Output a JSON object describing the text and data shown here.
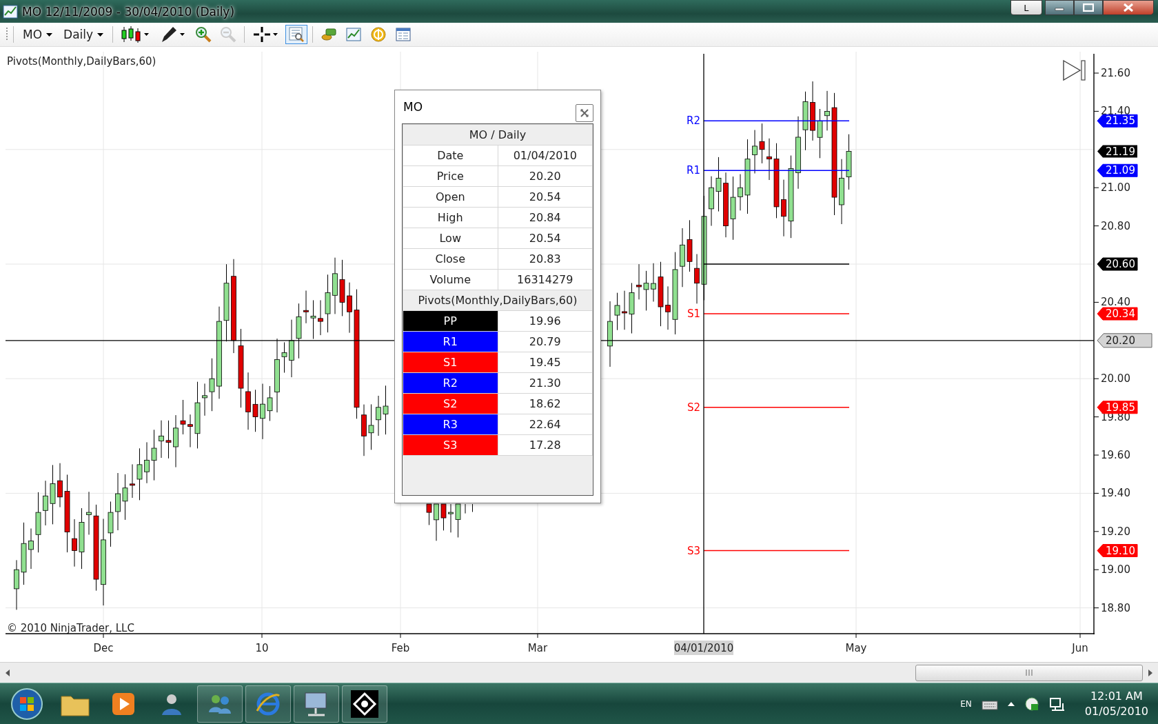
{
  "window": {
    "title": "MO  12/11/2009 - 30/04/2010 (Daily)",
    "buttons": [
      {
        "kind": "account",
        "label": "L"
      },
      {
        "kind": "minimize"
      },
      {
        "kind": "maximize"
      },
      {
        "kind": "close"
      }
    ]
  },
  "toolbar": {
    "instrument": "MO",
    "period": "Daily",
    "tools": [
      {
        "kind": "chart-style",
        "selected": false,
        "disabled": false
      },
      {
        "kind": "drawing",
        "selected": false,
        "disabled": false
      },
      {
        "kind": "zoom-in",
        "selected": false,
        "disabled": false
      },
      {
        "kind": "zoom-out",
        "selected": false,
        "disabled": true
      },
      {
        "kind": "crosshair",
        "selected": false,
        "disabled": false
      },
      {
        "kind": "data-box",
        "selected": true,
        "disabled": false
      },
      {
        "kind": "instruments",
        "selected": false,
        "disabled": false
      },
      {
        "kind": "indicators",
        "selected": false,
        "disabled": false
      },
      {
        "kind": "strategies",
        "selected": false,
        "disabled": false
      },
      {
        "kind": "properties",
        "selected": false,
        "disabled": false
      }
    ]
  },
  "chart": {
    "indicator": "Pivots(Monthly,DailyBars,60)",
    "copyright": "© 2010 NinjaTrader, LLC",
    "price_ticks": [
      "21.60",
      "21.40",
      "21.00",
      "20.80",
      "20.40",
      "20.00",
      "19.80",
      "19.60",
      "19.40",
      "19.20",
      "19.00",
      "18.80"
    ],
    "date_ticks": [
      "Dec",
      "10",
      "Feb",
      "Mar",
      "May",
      "Jun"
    ],
    "pivot_lines": [
      {
        "label": "R2",
        "marker": "21.35",
        "color": "#0000ff"
      },
      {
        "label": "R1",
        "marker": "21.09",
        "color": "#0000ff"
      },
      {
        "marker": "20.60",
        "color": "#000000"
      },
      {
        "label": "S1",
        "marker": "20.34",
        "color": "#ff0000"
      },
      {
        "label": "S2",
        "marker": "19.85",
        "color": "#ff0000"
      },
      {
        "label": "S3",
        "marker": "19.10",
        "color": "#ff0000"
      }
    ],
    "last_price": "21.19",
    "crosshair": {
      "price": "20.20",
      "date": "04/01/2010"
    }
  },
  "data_box": {
    "title": "MO",
    "header": "MO / Daily",
    "rows": [
      {
        "name": "Date",
        "value": "01/04/2010"
      },
      {
        "name": "Price",
        "value": "20.20"
      },
      {
        "name": "Open",
        "value": "20.54"
      },
      {
        "name": "High",
        "value": "20.84"
      },
      {
        "name": "Low",
        "value": "20.54"
      },
      {
        "name": "Close",
        "value": "20.83"
      },
      {
        "name": "Volume",
        "value": "16314279"
      }
    ],
    "section": "Pivots(Monthly,DailyBars,60)",
    "pivots": [
      {
        "name": "PP",
        "value": "19.96",
        "color": "#000000"
      },
      {
        "name": "R1",
        "value": "20.79",
        "color": "#0000ff"
      },
      {
        "name": "S1",
        "value": "19.45",
        "color": "#ff0000"
      },
      {
        "name": "R2",
        "value": "21.30",
        "color": "#0000ff"
      },
      {
        "name": "S2",
        "value": "18.62",
        "color": "#ff0000"
      },
      {
        "name": "R3",
        "value": "22.64",
        "color": "#0000ff"
      },
      {
        "name": "S3",
        "value": "17.28",
        "color": "#ff0000"
      }
    ]
  },
  "taskbar": {
    "language": "EN",
    "time": "12:01 AM",
    "date": "01/05/2010"
  }
}
